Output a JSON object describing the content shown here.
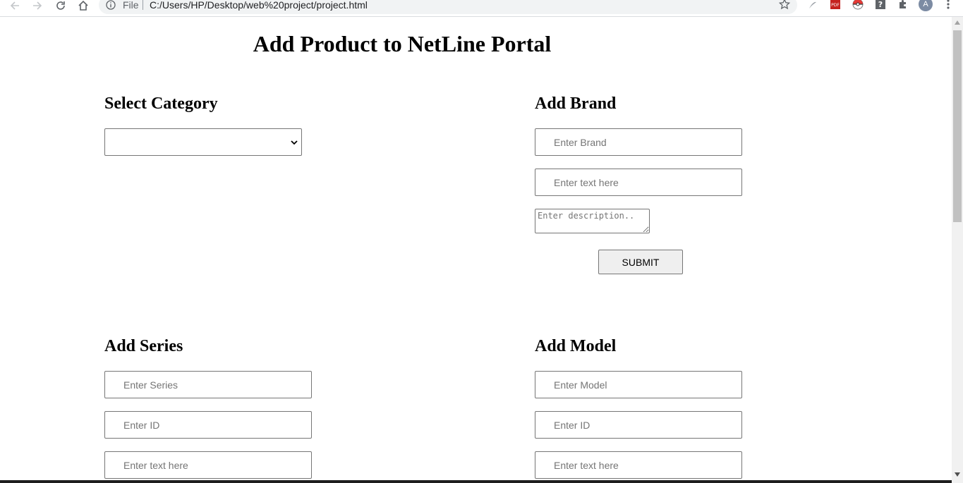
{
  "browser": {
    "file_label": "File",
    "url": "C:/Users/HP/Desktop/web%20project/project.html",
    "avatar_initial": "A",
    "extensions": [
      "acrobat-icon",
      "pdf-icon",
      "pokeball-icon",
      "help-icon",
      "puzzle-icon"
    ]
  },
  "page": {
    "title": "Add Product to NetLine Portal"
  },
  "category": {
    "heading": "Select Category",
    "selected_value": ""
  },
  "brand": {
    "heading": "Add Brand",
    "brand_placeholder": "Enter Brand",
    "text_placeholder": "Enter text here",
    "description_placeholder": "Enter description..",
    "submit_label": "SUBMIT"
  },
  "series": {
    "heading": "Add Series",
    "series_placeholder": "Enter Series",
    "id_placeholder": "Enter ID",
    "text_placeholder": "Enter text here"
  },
  "model": {
    "heading": "Add Model",
    "model_placeholder": "Enter Model",
    "id_placeholder": "Enter ID",
    "text_placeholder": "Enter text here"
  },
  "colors": {
    "border": "#767676",
    "placeholder": "#757575",
    "button_bg": "#efefef"
  }
}
